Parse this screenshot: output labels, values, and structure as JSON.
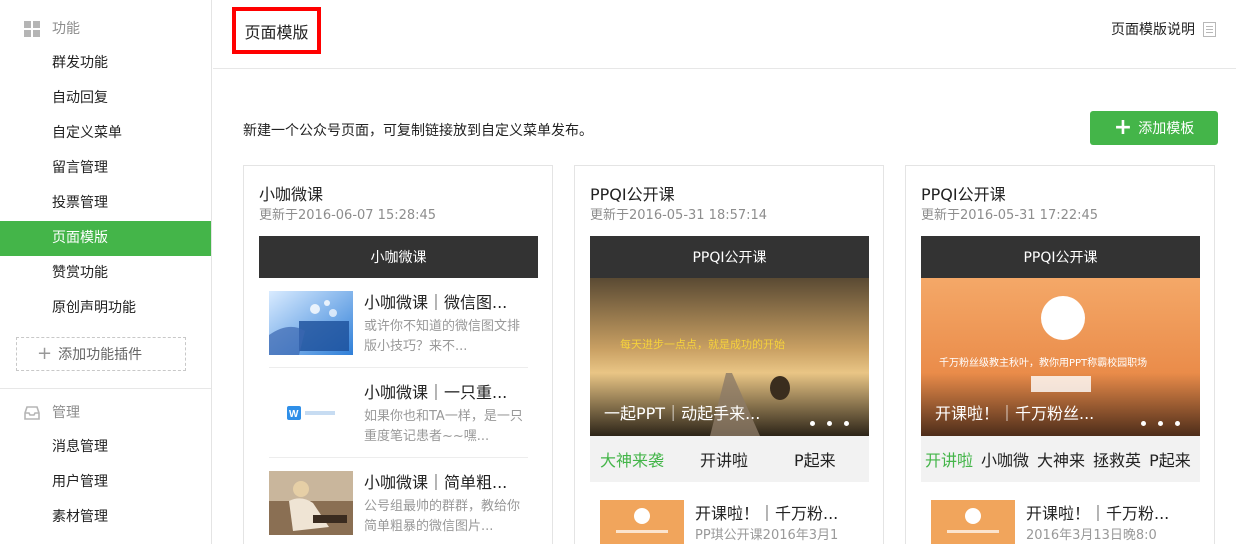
{
  "sidebar": {
    "func_heading": "功能",
    "func_items": [
      "群发功能",
      "自动回复",
      "自定义菜单",
      "留言管理",
      "投票管理",
      "页面模版",
      "赞赏功能",
      "原创声明功能"
    ],
    "active_index": 5,
    "add_plugin_label": "添加功能插件",
    "manage_heading": "管理",
    "manage_items": [
      "消息管理",
      "用户管理",
      "素材管理"
    ]
  },
  "header": {
    "title": "页面模版",
    "help_label": "页面模版说明"
  },
  "description": "新建一个公众号页面，可复制链接放到自定义菜单发布。",
  "add_template_label": "添加模板",
  "accent_color": "#44b549",
  "cards": [
    {
      "title": "小咖微课",
      "updated": "更新于2016-06-07 15:28:45",
      "preview_header": "小咖微课",
      "articles": [
        {
          "title": "小咖微课｜微信图...",
          "summary": "或许你不知道的微信图文排版小技巧？来不..."
        },
        {
          "title": "小咖微课｜一只重...",
          "summary": "如果你也和TA一样，是一只重度笔记患者~~嘿..."
        },
        {
          "title": "小咖微课｜简单粗...",
          "summary": "公号组最帅的群群，教给你简单粗暴的微信图片..."
        }
      ]
    },
    {
      "title": "PPQI公开课",
      "updated": "更新于2016-05-31 18:57:14",
      "preview_header": "PPQI公开课",
      "banner_caption": "一起PPT｜动起手来...",
      "banner_text": "每天进步一点点，就是成功的开始",
      "tabs": [
        "大神来袭",
        "开讲啦",
        "P起来"
      ],
      "sub_article": {
        "title": "开课啦！｜千万粉...",
        "summary": "PP琪公开课2016年3月1"
      }
    },
    {
      "title": "PPQI公开课",
      "updated": "更新于2016-05-31 17:22:45",
      "preview_header": "PPQI公开课",
      "banner_caption": "开课啦！｜千万粉丝...",
      "banner_text": "千万粉丝级教主秋叶，教你用PPT称霸校园职场",
      "tabs": [
        "开讲啦",
        "小咖微",
        "大神来",
        "拯救英",
        "P起来"
      ],
      "sub_article": {
        "title": "开课啦！｜千万粉...",
        "summary": "2016年3月13日晚8:0"
      }
    }
  ]
}
